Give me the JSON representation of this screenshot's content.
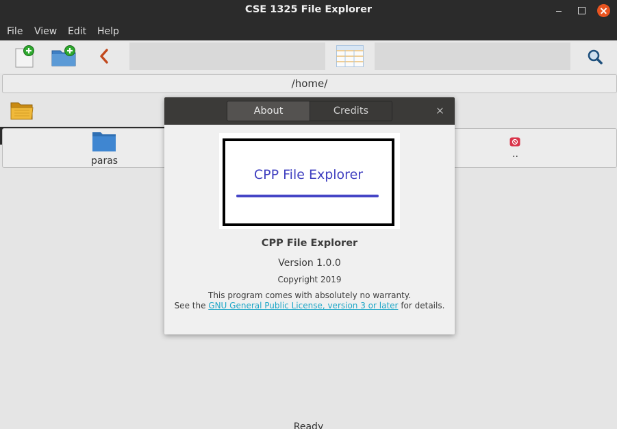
{
  "window": {
    "title": "CSE 1325 File Explorer"
  },
  "menu": {
    "items": [
      "File",
      "View",
      "Edit",
      "Help"
    ]
  },
  "toolbar": {
    "icons": [
      "new-file-icon",
      "new-folder-icon",
      "back-icon",
      "grid-view-icon",
      "search-icon"
    ],
    "path": "/home/"
  },
  "files": [
    {
      "name": "paras",
      "icon": "folder-icon"
    },
    {
      "name": "..",
      "icon": "parent-directory-icon"
    }
  ],
  "status": {
    "text": "Ready"
  },
  "about_dialog": {
    "tabs": [
      "About",
      "Credits"
    ],
    "selected_tab": "About",
    "logo_text": "CPP File Explorer",
    "program_name": "CPP File Explorer",
    "version": "Version 1.0.0",
    "copyright": "Copyright 2019",
    "warranty": "This program comes with absolutely no warranty.",
    "license_prefix": "See the",
    "license_link": "GNU General Public License, version 3 or later",
    "license_suffix": "for details."
  },
  "colors": {
    "accent_close": "#e95420",
    "link": "#1ea6c7",
    "logo_blue": "#4040c0"
  }
}
